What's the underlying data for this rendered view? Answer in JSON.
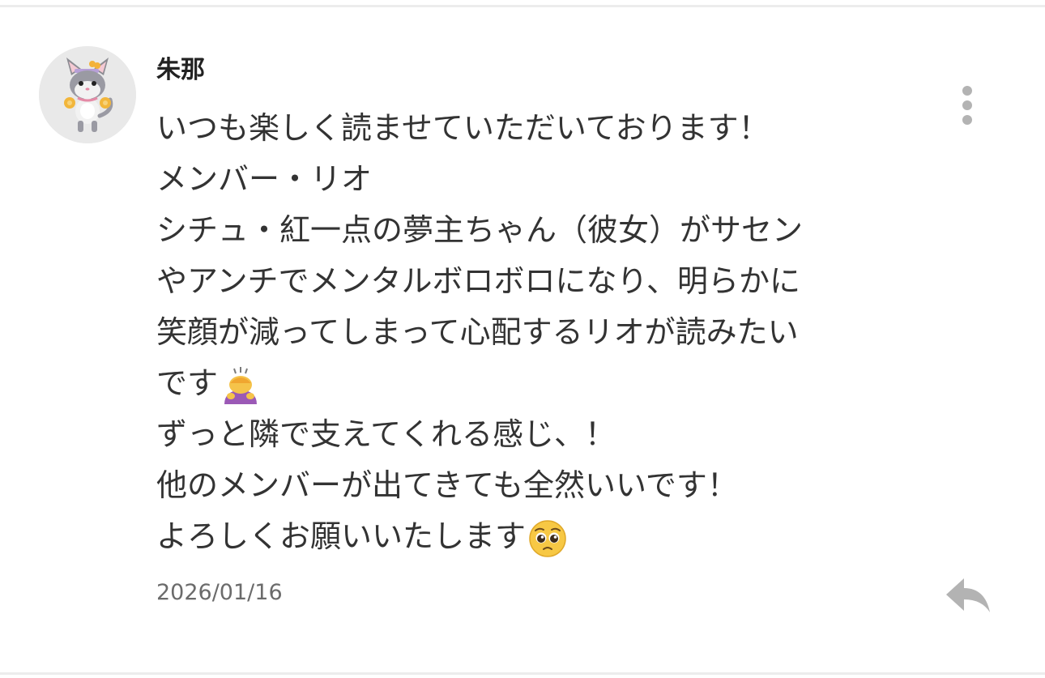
{
  "comment": {
    "author": "朱那",
    "lines": [
      "いつも楽しく読ませていただいております！",
      "メンバー・リオ",
      "シチュ・紅一点の夢主ちゃん（彼女）がサセン",
      "やアンチでメンタルボロボロになり、明らかに",
      "笑顔が減ってしまって心配するリオが読みたい",
      "です",
      "ずっと隣で支えてくれる感じ、！",
      "他のメンバーが出てきても全然いいです！",
      "よろしくお願いいたします"
    ],
    "line_emojis": {
      "5": "person-bowing-emoji",
      "8": "pleading-face-emoji"
    },
    "date": "2026/01/16"
  },
  "icons": {
    "avatar": "cat-mascot-avatar",
    "more": "vertical-dots-icon",
    "reply": "reply-arrow-icon"
  },
  "colors": {
    "background": "#ffffff",
    "text": "#333333",
    "date_text": "#6b6b6b",
    "icon_gray": "#b3b3b3",
    "divider": "#ececec"
  }
}
